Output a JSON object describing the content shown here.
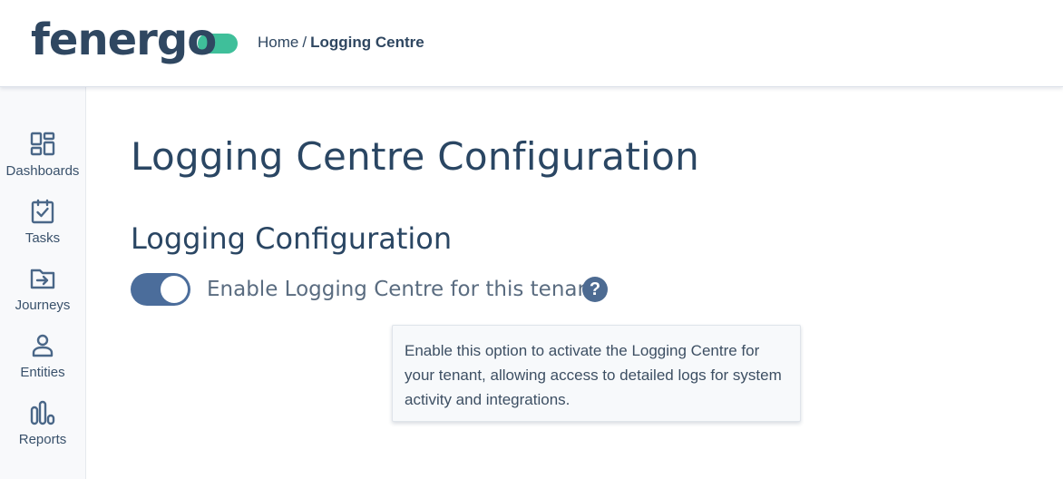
{
  "header": {
    "logo_text": "fenergo",
    "breadcrumb": {
      "home": "Home",
      "separator": "/",
      "current": "Logging Centre"
    }
  },
  "sidebar": {
    "items": [
      {
        "label": "Dashboards",
        "icon": "dashboard-icon"
      },
      {
        "label": "Tasks",
        "icon": "clipboard-check-icon"
      },
      {
        "label": "Journeys",
        "icon": "folder-arrow-icon"
      },
      {
        "label": "Entities",
        "icon": "person-icon"
      },
      {
        "label": "Reports",
        "icon": "bar-chart-icon"
      }
    ]
  },
  "main": {
    "page_title": "Logging Centre Configuration",
    "section_title": "Logging Configuration",
    "toggle": {
      "label": "Enable Logging Centre for this tenant",
      "state": "on"
    },
    "help_icon": "?",
    "tooltip": "Enable this option to activate the Logging Centre for your tenant, allowing access to detailed logs for system activity and integrations."
  },
  "colors": {
    "brand_dark": "#2f4761",
    "brand_green": "#3fbf9a",
    "toggle_on": "#4b6d9b",
    "sidebar_bg": "#f8f9fb"
  }
}
